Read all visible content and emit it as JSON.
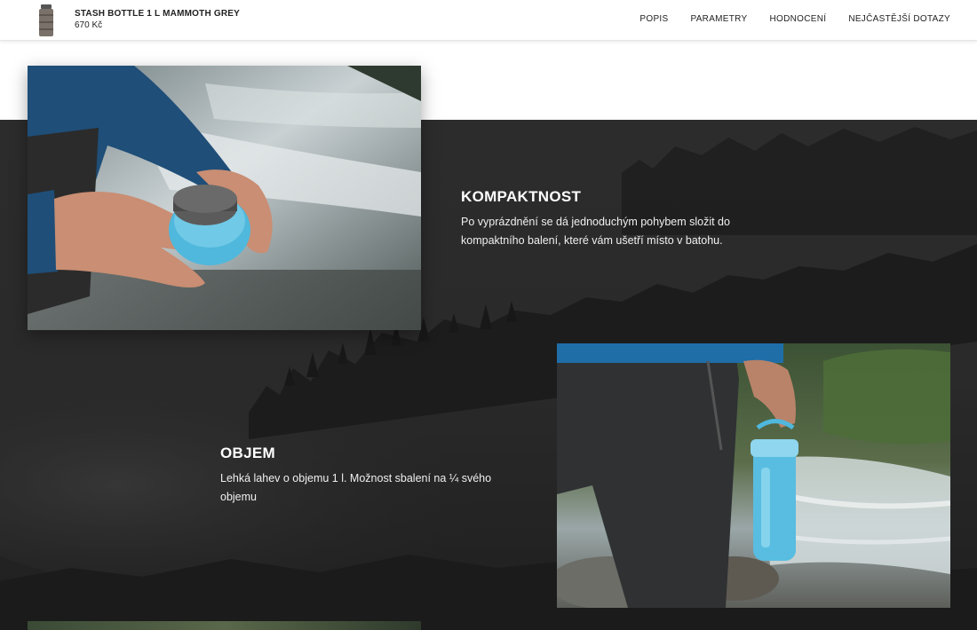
{
  "header": {
    "product_name": "STASH BOTTLE 1 L MAMMOTH GREY",
    "price": "670 Kč",
    "nav": [
      "POPIS",
      "PARAMETRY",
      "HODNOCENÍ",
      "NEJČASTĚJŠÍ DOTAZY"
    ]
  },
  "features": [
    {
      "title": "KOMPAKTNOST",
      "text": "Po vyprázdnění se dá jednoduchým pohybem složit do kompaktního balení, které vám ušetří místo v batohu."
    },
    {
      "title": "OBJEM",
      "text": "Lehká lahev o objemu 1 l. Možnost sbalení na ¼ svého objemu"
    }
  ],
  "colors": {
    "dark_section": "#262626",
    "bottle_blue": "#4fb8dc",
    "accent_text": "#ffffff"
  }
}
